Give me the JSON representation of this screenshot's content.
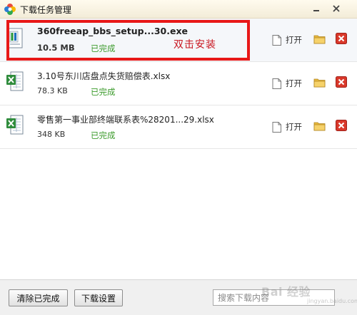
{
  "window": {
    "title": "下载任务管理",
    "app_icon": "colorful-flower-logo",
    "controls": {
      "minimize_icon": "minimize-icon",
      "close_icon": "close-icon"
    }
  },
  "downloads": [
    {
      "name": "360freeap_bbs_setup...30.exe",
      "size": "10.5 MB",
      "status": "已完成",
      "type": "exe-icon",
      "open_label": "打开"
    },
    {
      "name": "3.10号东川店盘点失货赔偿表.xlsx",
      "size": "78.3 KB",
      "status": "已完成",
      "type": "excel-icon",
      "open_label": "打开"
    },
    {
      "name": "零售第一事业部终端联系表%28201...29.xlsx",
      "size": "348 KB",
      "status": "已完成",
      "type": "excel-icon",
      "open_label": "打开"
    }
  ],
  "annotation": {
    "text": "双击安装",
    "color": "#c8141e"
  },
  "footer": {
    "clear_label": "清除已完成",
    "settings_label": "下载设置",
    "search_placeholder": "搜索下载内容"
  },
  "watermark": {
    "text": "Bai 经验",
    "sub": "jingyan.baidu.com"
  },
  "colors": {
    "status_done": "#3a9a2a",
    "highlight_border": "#e81818",
    "title_bg": "#fffbee"
  }
}
